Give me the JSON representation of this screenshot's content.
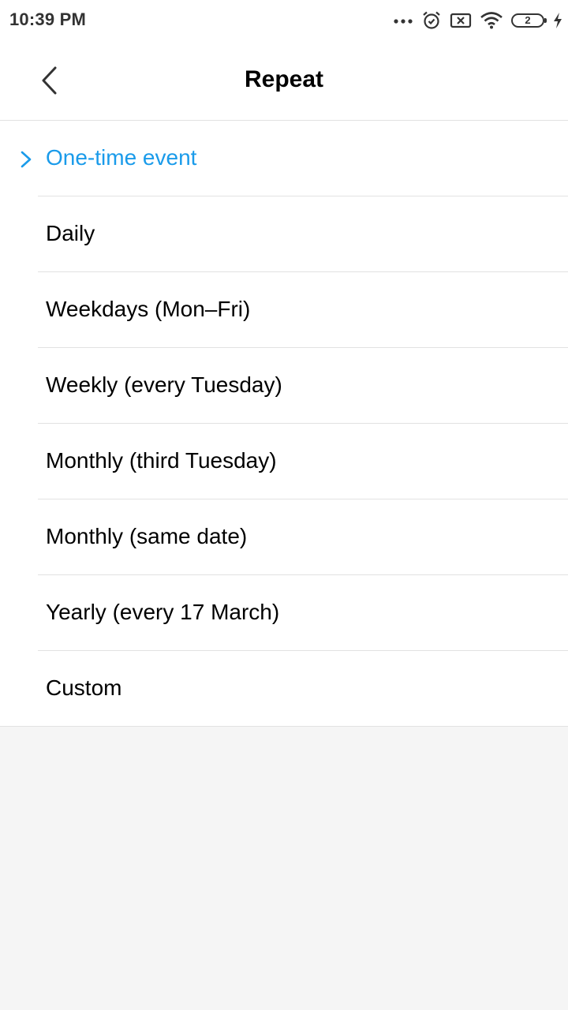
{
  "status_bar": {
    "time": "10:39 PM",
    "battery_level": "2",
    "icons": [
      "more-dots-icon",
      "alarm-icon",
      "sim-x-icon",
      "wifi-icon",
      "battery-icon",
      "charging-bolt-icon"
    ]
  },
  "header": {
    "title": "Repeat",
    "back_icon": "chevron-left-icon"
  },
  "options": [
    {
      "label": "One-time event",
      "selected": true
    },
    {
      "label": "Daily",
      "selected": false
    },
    {
      "label": "Weekdays (Mon–Fri)",
      "selected": false
    },
    {
      "label": "Weekly (every Tuesday)",
      "selected": false
    },
    {
      "label": "Monthly (third Tuesday)",
      "selected": false
    },
    {
      "label": "Monthly (same date)",
      "selected": false
    },
    {
      "label": "Yearly (every 17 March)",
      "selected": false
    },
    {
      "label": "Custom",
      "selected": false
    }
  ],
  "colors": {
    "accent": "#1a9bea",
    "text": "#000000",
    "divider": "#e2e2e2",
    "background": "#f5f5f5",
    "surface": "#ffffff"
  }
}
